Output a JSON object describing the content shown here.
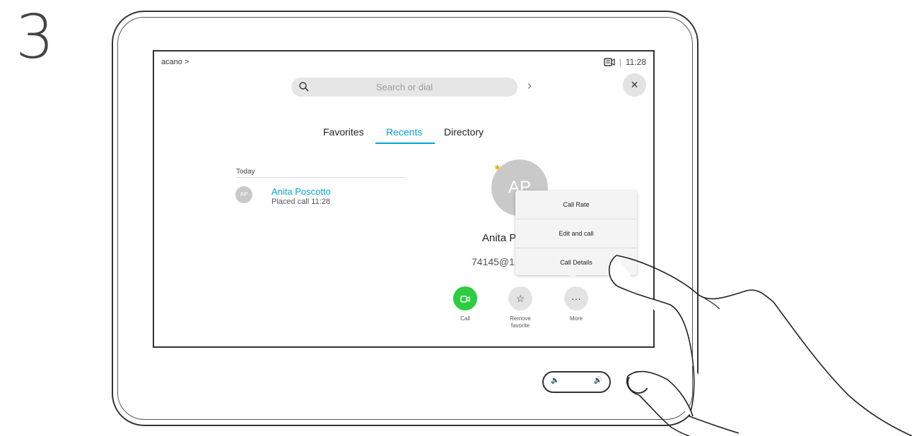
{
  "step_number": "3",
  "screen": {
    "brand": "acano >",
    "camera_icon": "camera-icon",
    "status_separator": "|",
    "time": "11:28",
    "search": {
      "placeholder": "Search or dial",
      "icon": "search-icon",
      "go_icon": "chevron-right-icon"
    },
    "close_icon": "close-icon",
    "tabs": [
      {
        "label": "Favorites"
      },
      {
        "label": "Recents"
      },
      {
        "label": "Directory"
      }
    ],
    "active_tab": "Recents",
    "section_label": "Today",
    "recents": [
      {
        "initials": "AP",
        "name": "Anita Poscotto",
        "detail": "Placed call 11:28"
      }
    ],
    "contact": {
      "initials": "AP",
      "name_visible": "Anita P",
      "address_visible": "74145@1",
      "favorite_icon": "star-icon"
    },
    "actions": [
      {
        "label": "Call",
        "icon": "video-icon",
        "color": "#2ecc40"
      },
      {
        "label_line1": "Remove",
        "label_line2": "favorite",
        "icon": "star-outline-icon"
      },
      {
        "label": "More",
        "icon": "more-icon"
      }
    ],
    "more_menu": [
      {
        "label": "Call Rate"
      },
      {
        "label": "Edit and call"
      },
      {
        "label": "Call Details"
      }
    ]
  },
  "hardware": {
    "volume_down_icon": "volume-down-icon",
    "volume_up_icon": "volume-up-icon",
    "home_button": "home-button"
  },
  "colors": {
    "accent": "#00a6d6",
    "call_green": "#2ecc40",
    "favorite_star": "#e6b000"
  }
}
